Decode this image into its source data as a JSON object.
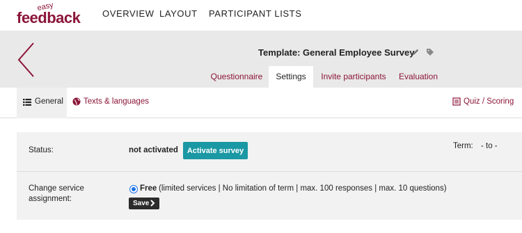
{
  "brand": {
    "logo_small": "easy",
    "logo_main": "feedback",
    "color": "#8b1538"
  },
  "topnav": [
    "OVERVIEW",
    "LAYOUT",
    "PARTICIPANT LISTS"
  ],
  "header": {
    "title": "Template: General Employee Survey",
    "icons": [
      "pencil-icon",
      "tag-icon",
      "back-arrow-icon"
    ],
    "tabs": [
      {
        "label": "Questionnaire",
        "active": false
      },
      {
        "label": "Settings",
        "active": true
      },
      {
        "label": "Invite participants",
        "active": false
      },
      {
        "label": "Evaluation",
        "active": false
      }
    ]
  },
  "subtabs": {
    "general": "General",
    "texts": "Texts & languages",
    "quiz": "Quiz / Scoring",
    "icons": [
      "list-icon",
      "globe-icon",
      "book-icon"
    ]
  },
  "settings": {
    "status_label": "Status:",
    "status_value": "not activated",
    "activate_label": "Activate survey",
    "term_label": "Term:",
    "term_value": "- to -",
    "service_label": "Change service assignment:",
    "service_name": "Free",
    "service_desc": "(limited services | No limitation of term | max. 100 responses | max. 10 questions)",
    "save_label": "Save",
    "accent": "#1a98a3"
  }
}
